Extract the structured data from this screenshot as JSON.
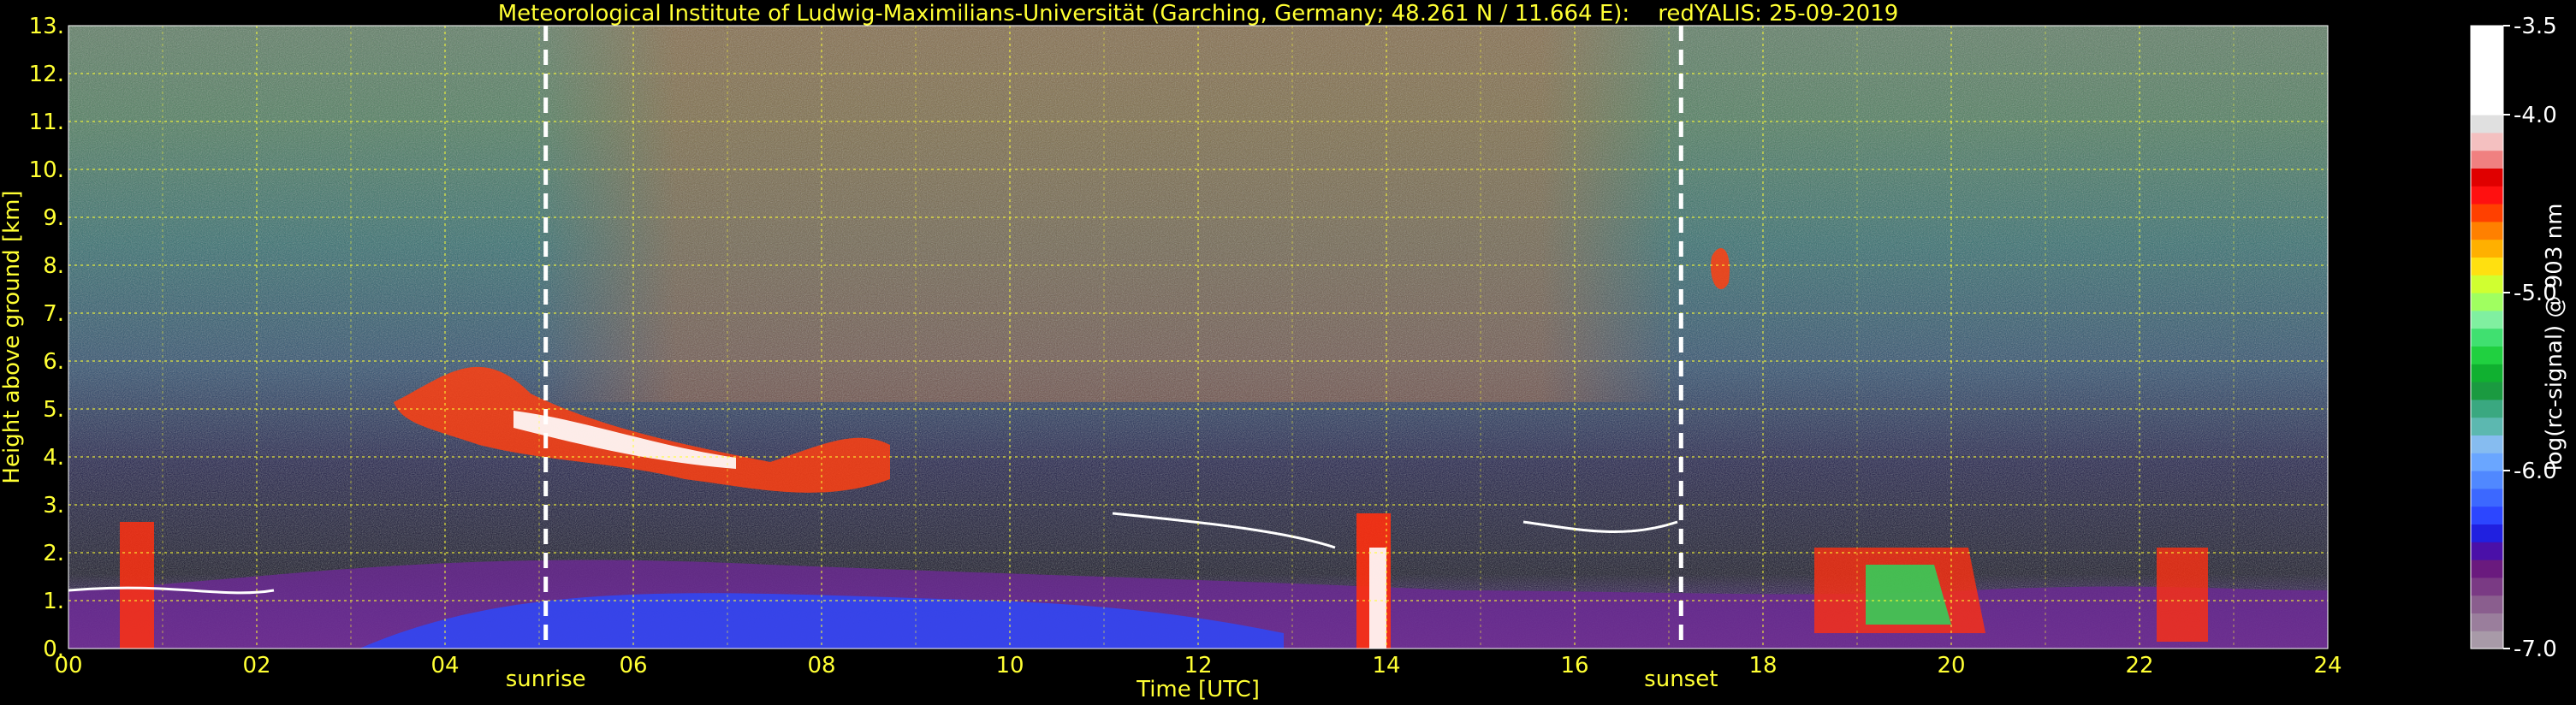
{
  "chart_data": {
    "type": "heatmap",
    "title": "Meteorological Institute of Ludwig-Maximilians-Universität (Garching, Germany; 48.261 N / 11.664 E):    redYALIS: 25-09-2019",
    "xlabel": "Time [UTC]",
    "ylabel": "Height above ground [km]",
    "colorbar_label": "log(rc-signal) @ 903 nm",
    "xlim": [
      0,
      24
    ],
    "ylim": [
      0,
      13
    ],
    "clim": [
      -7.0,
      -3.5
    ],
    "grid": true,
    "grid_color": "#ffff33",
    "x_ticks": [
      0,
      2,
      4,
      6,
      8,
      10,
      12,
      14,
      16,
      18,
      20,
      22,
      24
    ],
    "x_tick_labels": [
      "00",
      "02",
      "04",
      "06",
      "08",
      "10",
      "12",
      "14",
      "16",
      "18",
      "20",
      "22",
      "24"
    ],
    "y_ticks": [
      0,
      1,
      2,
      3,
      4,
      5,
      6,
      7,
      8,
      9,
      10,
      11,
      12,
      13
    ],
    "y_tick_labels": [
      "0.",
      "1.",
      "2.",
      "3.",
      "4.",
      "5.",
      "6.",
      "7.",
      "8.",
      "9.",
      "10.",
      "11.",
      "12.",
      "13."
    ],
    "colorbar_ticks": [
      -3.5,
      -4.0,
      -5.0,
      -6.0,
      -7.0
    ],
    "colorbar_tick_labels": [
      "-3.5",
      "-4.0",
      "-5.0",
      "-6.0",
      "-7.0"
    ],
    "colorbar_colors": [
      "#a89aa8",
      "#9a7e9c",
      "#8a5e8e",
      "#7a3a84",
      "#6a1a7e",
      "#4a10a8",
      "#2020e0",
      "#2c46ff",
      "#3c68ff",
      "#5088ff",
      "#6aa6ff",
      "#86bcf0",
      "#5cb8b0",
      "#3aa880",
      "#1a9a40",
      "#10b030",
      "#20d040",
      "#40e070",
      "#80f0a0",
      "#a0ff60",
      "#d0ff30",
      "#ffe010",
      "#ffb000",
      "#ff8000",
      "#ff4000",
      "#ff1010",
      "#e00000",
      "#f08080",
      "#f4c0c0",
      "#e0e0e0",
      "#ffffff",
      "#ffffff",
      "#ffffff",
      "#ffffff",
      "#ffffff"
    ],
    "annotations": [
      {
        "label": "sunrise",
        "x": 5.07
      },
      {
        "label": "sunset",
        "x": 17.13
      }
    ]
  }
}
